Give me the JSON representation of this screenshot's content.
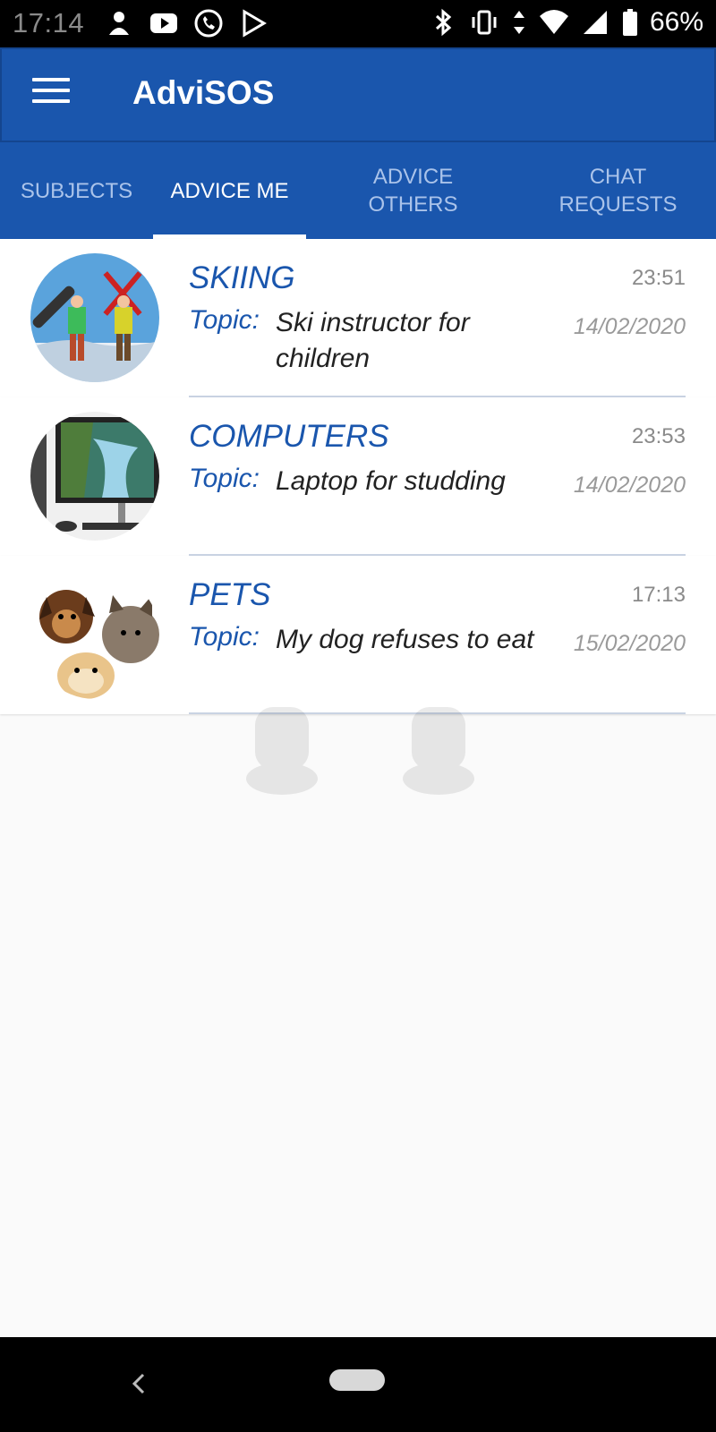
{
  "status_bar": {
    "time": "17:14",
    "battery": "66%",
    "icons_left": [
      "notification-app-icon",
      "youtube-icon",
      "call-icon",
      "play-store-icon"
    ],
    "icons_right": [
      "bluetooth-icon",
      "vibrate-icon",
      "data-arrows-icon",
      "wifi-icon",
      "signal-icon",
      "battery-icon"
    ]
  },
  "app_bar": {
    "title": "AdviSOS",
    "menu_icon": "hamburger-menu-icon"
  },
  "tabs": [
    {
      "label": "SUBJECTS",
      "active": false
    },
    {
      "label": "ADVICE ME",
      "active": true
    },
    {
      "label": "ADVICE OTHERS",
      "active": false
    },
    {
      "label": "CHAT REQUESTS",
      "active": false
    }
  ],
  "conversations": [
    {
      "subject": "SKIING",
      "topic_label": "Topic:",
      "topic": "Ski instructor for children",
      "time": "23:51",
      "date": "14/02/2020",
      "image": "skiers-photo"
    },
    {
      "subject": "COMPUTERS",
      "topic_label": "Topic:",
      "topic": "Laptop for studding",
      "time": "23:53",
      "date": "14/02/2020",
      "image": "computer-photo"
    },
    {
      "subject": "PETS",
      "topic_label": "Topic:",
      "topic": "My dog refuses to eat",
      "time": "17:13",
      "date": "15/02/2020",
      "image": "pets-photo"
    }
  ],
  "colors": {
    "primary": "#1a56ad",
    "tab_inactive": "#aac3ea",
    "background": "#fafafa"
  },
  "nav_bar": {
    "back_icon": "back-chevron-icon",
    "home_icon": "home-pill-icon"
  }
}
